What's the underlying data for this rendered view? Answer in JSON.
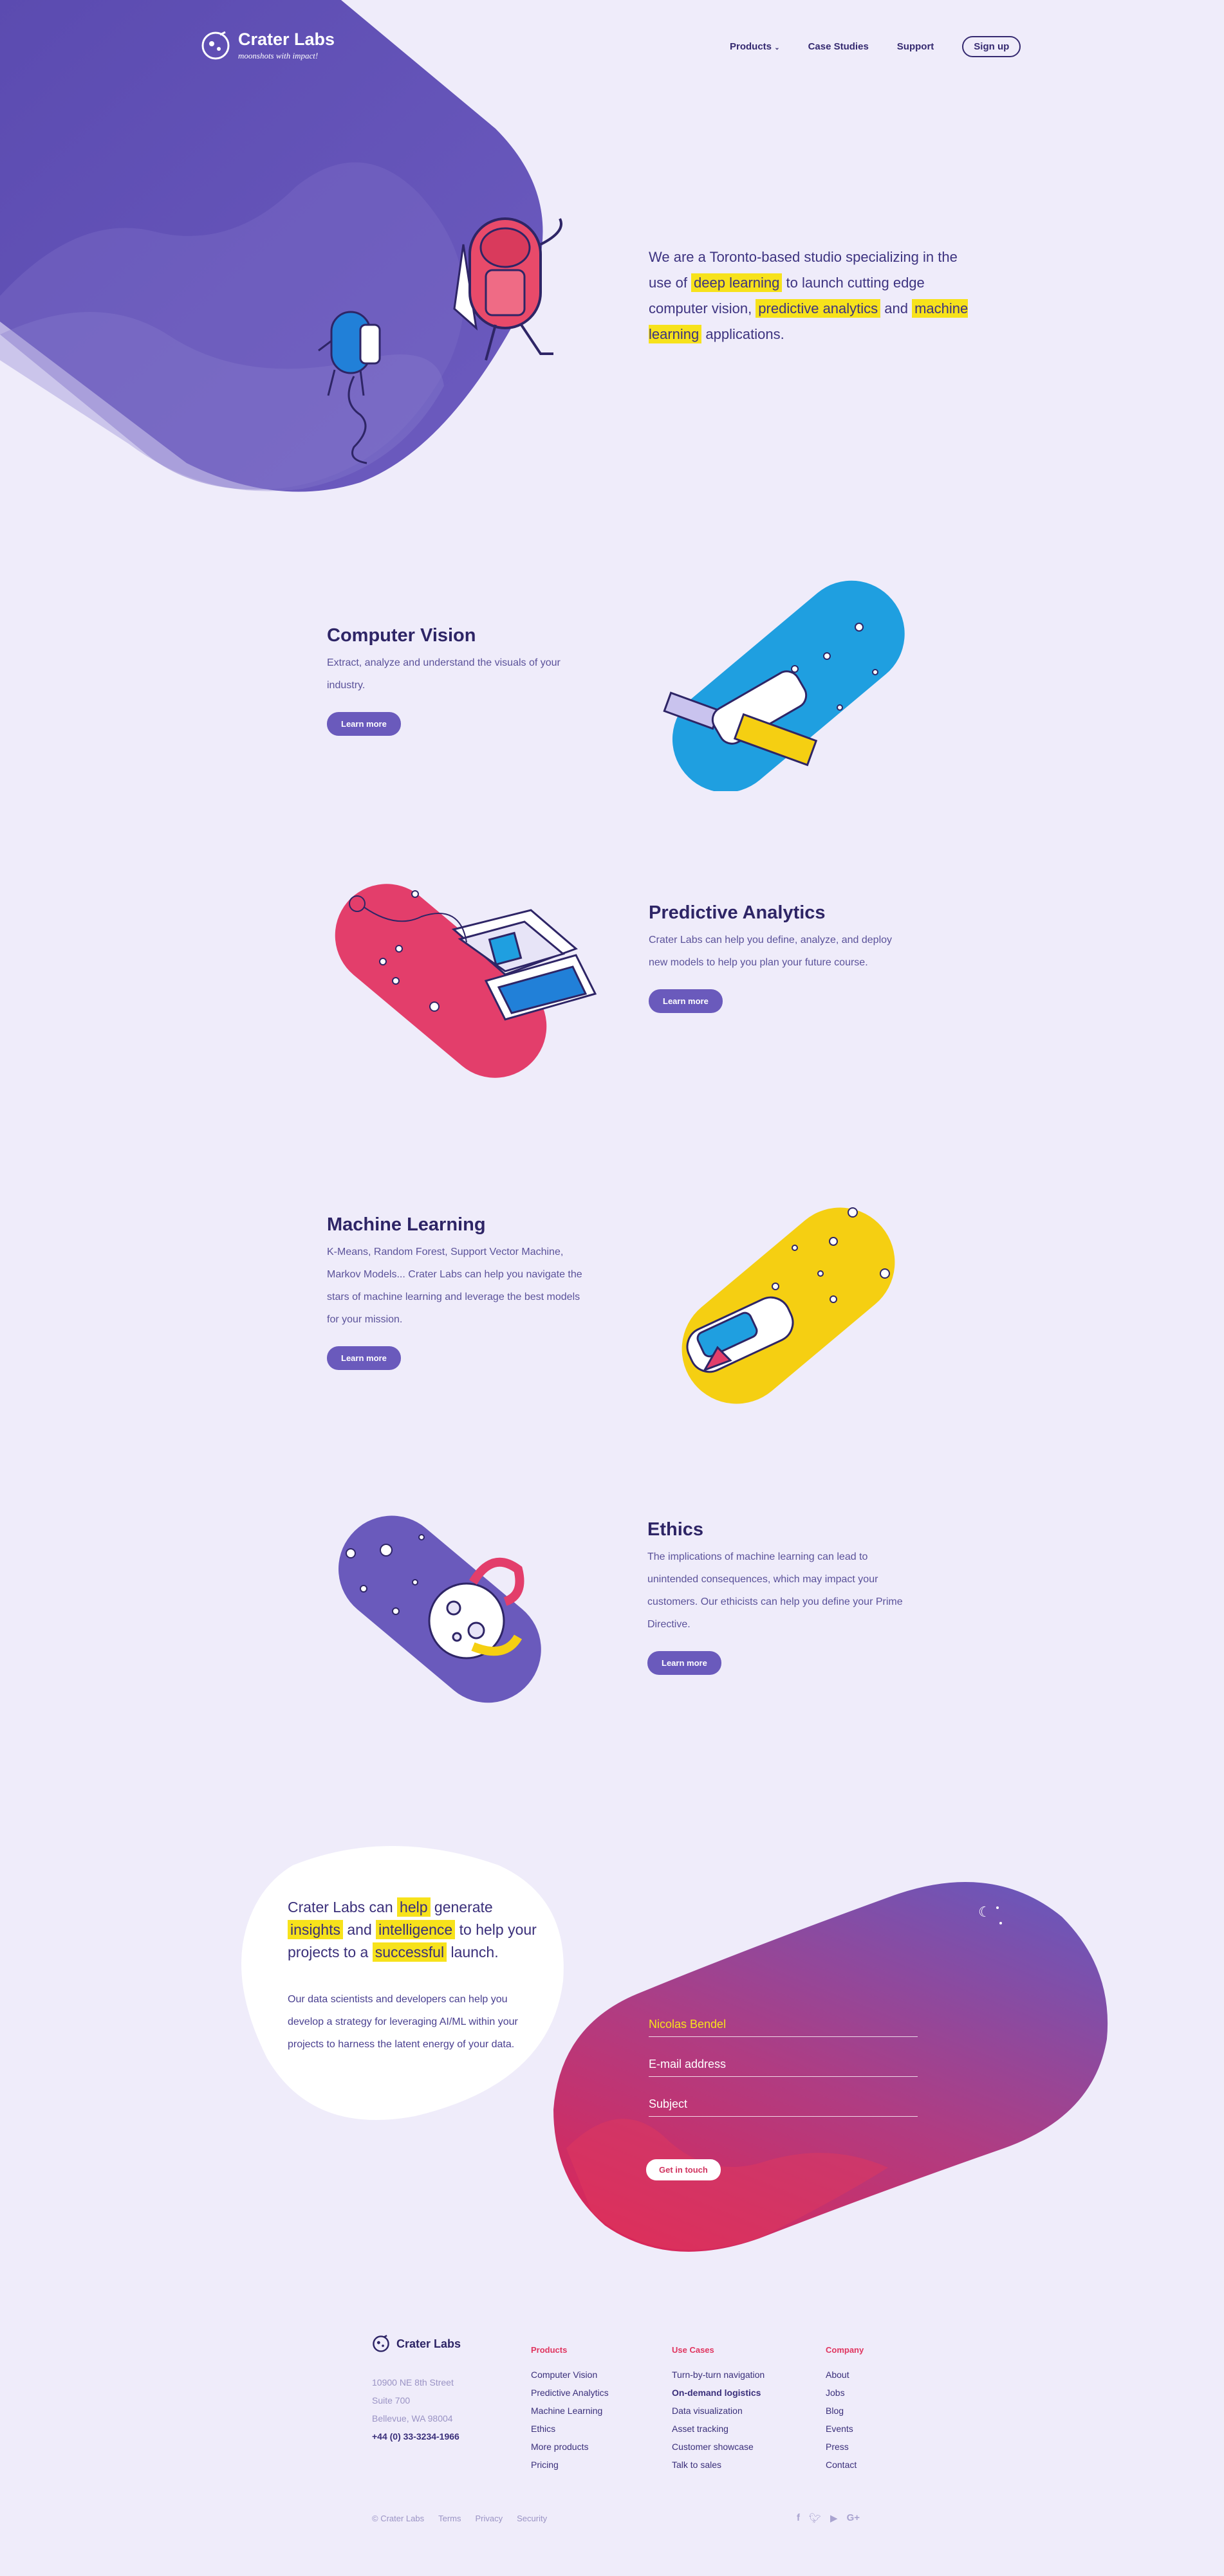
{
  "brand": {
    "name": "Crater Labs",
    "tagline": "moonshots with impact!"
  },
  "nav": {
    "products": "Products",
    "case_studies": "Case Studies",
    "support": "Support",
    "signup": "Sign up"
  },
  "hero": {
    "t1": "We are a Toronto-based studio specializing in the use of ",
    "h1": "deep learning",
    "t2": " to launch cutting edge computer vision, ",
    "h2": "predictive analytics",
    "t3": " and ",
    "h3": "machine learning",
    "t4": " applications."
  },
  "services": [
    {
      "title": "Computer Vision",
      "desc": "Extract, analyze and understand the visuals of your industry.",
      "cta": "Learn more",
      "color": "#1f9fe0"
    },
    {
      "title": "Predictive Analytics",
      "desc": "Crater Labs can help you define, analyze, and deploy new models to help you plan your future course.",
      "cta": "Learn more",
      "color": "#e33e6b"
    },
    {
      "title": "Machine Learning",
      "desc": "K-Means, Random Forest, Support Vector Machine, Markov Models... Crater Labs can help you navigate the stars of machine learning and leverage the best models for your mission.",
      "cta": "Learn more",
      "color": "#f5cf12"
    },
    {
      "title": "Ethics",
      "desc": "The implications of machine learning can lead to unintended consequences, which may impact your customers. Our ethicists can help you define your Prime Directive.",
      "cta": "Learn more",
      "color": "#6a5abc"
    }
  ],
  "contact": {
    "t1": "Crater Labs can ",
    "h1": "help",
    "t2": " generate ",
    "h2": "insights",
    "t3": " and ",
    "h3": "intelligence",
    "t4": " to help your projects to a ",
    "h4": "successful",
    "t5": " launch.",
    "body": "Our data scientists and developers can help you develop a strategy for leveraging AI/ML within your projects to harness the latent energy of your data.",
    "name_value": "Nicolas Bendel",
    "email_placeholder": "E-mail address",
    "subject_placeholder": "Subject",
    "submit": "Get in touch"
  },
  "footer": {
    "brand": "Crater Labs",
    "address": [
      "10900 NE 8th Street",
      "Suite 700",
      "Bellevue, WA 98004"
    ],
    "phone": "+44 (0) 33-3234-1966",
    "columns": [
      {
        "heading": "Products",
        "items": [
          "Computer Vision",
          "Predictive Analytics",
          "Machine Learning",
          "Ethics",
          "More products",
          "Pricing"
        ]
      },
      {
        "heading": "Use Cases",
        "items": [
          "Turn-by-turn navigation",
          "On-demand logistics",
          "Data visualization",
          "Asset tracking",
          "Customer showcase",
          "Talk to sales"
        ]
      },
      {
        "heading": "Company",
        "items": [
          "About",
          "Jobs",
          "Blog",
          "Events",
          "Press",
          "Contact"
        ]
      }
    ],
    "copyright": "© Crater Labs",
    "legal": [
      "Terms",
      "Privacy",
      "Security"
    ]
  },
  "colors": {
    "bg": "#efecfa",
    "purple": "#6a5abc",
    "highlight": "#f7e21b",
    "pink": "#e0355f"
  },
  "icons": [
    "moon-logo-icon",
    "chevron-down-icon",
    "facebook-icon",
    "twitter-icon",
    "youtube-icon",
    "google-plus-icon"
  ]
}
